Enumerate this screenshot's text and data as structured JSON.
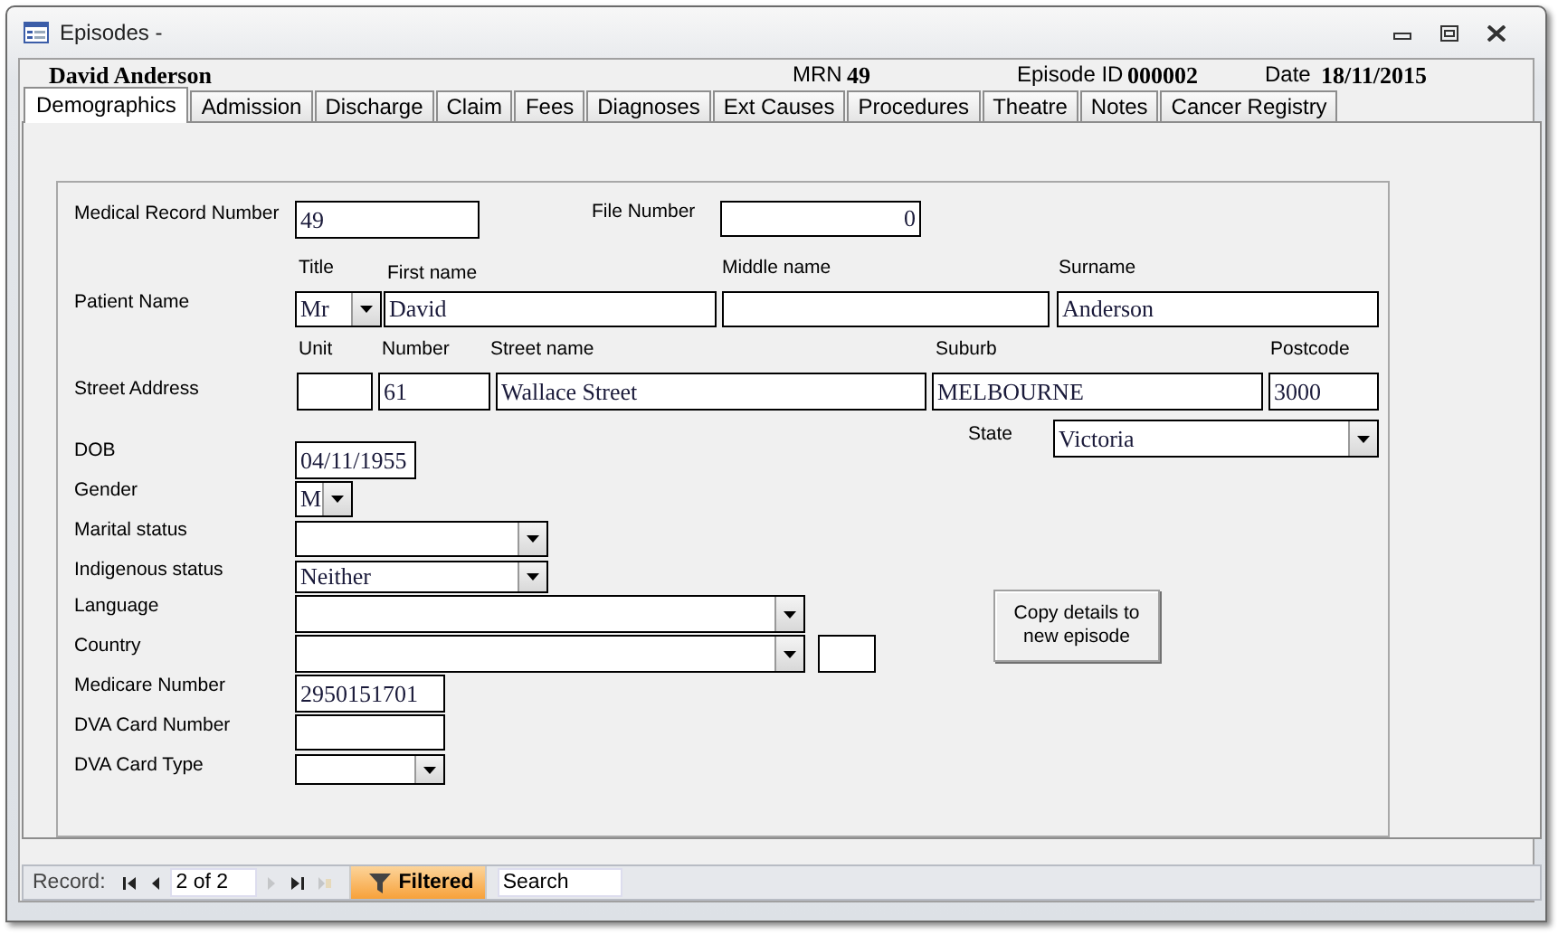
{
  "window": {
    "title": "Episodes -"
  },
  "header": {
    "patient": "David Anderson",
    "mrn_label": "MRN",
    "mrn": "49",
    "episode_label": "Episode ID",
    "episode": "000002",
    "date_label": "Date",
    "date": "18/11/2015"
  },
  "tabs": [
    {
      "label": "Demographics",
      "selected": true
    },
    {
      "label": "Admission",
      "selected": false
    },
    {
      "label": "Discharge",
      "selected": false
    },
    {
      "label": "Claim",
      "selected": false
    },
    {
      "label": "Fees",
      "selected": false
    },
    {
      "label": "Diagnoses",
      "selected": false
    },
    {
      "label": "Ext Causes",
      "selected": false
    },
    {
      "label": "Procedures",
      "selected": false
    },
    {
      "label": "Theatre",
      "selected": false
    },
    {
      "label": "Notes",
      "selected": false
    },
    {
      "label": "Cancer Registry",
      "selected": false
    }
  ],
  "form": {
    "labels": [
      "Medical Record Number",
      "File Number",
      "Title",
      "First name",
      "Middle name",
      "Surname",
      "Patient Name",
      "Unit",
      "Number",
      "Street name",
      "Suburb",
      "Postcode",
      "Street Address",
      "State",
      "DOB",
      "Gender",
      "Marital status",
      "Indigenous status",
      "Language",
      "Country",
      "Medicare Number",
      "DVA Card Number",
      "DVA Card Type"
    ],
    "fields": [
      {
        "kind": "text",
        "value": "49"
      },
      {
        "kind": "text",
        "value": "0"
      },
      {
        "kind": "combo",
        "value": "Mr"
      },
      {
        "kind": "text",
        "value": "David"
      },
      {
        "kind": "text"
      },
      {
        "kind": "text",
        "value": "Anderson"
      },
      {
        "kind": "text"
      },
      {
        "kind": "text",
        "value": "61"
      },
      {
        "kind": "text",
        "value": "Wallace Street"
      },
      {
        "kind": "text",
        "value": "MELBOURNE"
      },
      {
        "kind": "text",
        "value": "3000"
      },
      {
        "kind": "combo",
        "value": "Victoria"
      },
      {
        "kind": "text",
        "value": "04/11/1955"
      },
      {
        "kind": "combo",
        "value": "M"
      },
      {
        "kind": "combo"
      },
      {
        "kind": "combo",
        "value": "Neither"
      },
      {
        "kind": "combo"
      },
      {
        "kind": "combo"
      },
      {
        "kind": "text"
      },
      {
        "kind": "text",
        "value": "2950151701"
      },
      {
        "kind": "text"
      },
      {
        "kind": "combo"
      }
    ],
    "copy_button": "Copy details to new episode"
  },
  "navigation": {
    "label": "Record:",
    "position": "2 of 2",
    "filter": "Filtered",
    "search": {
      "placeholder": "Search"
    }
  }
}
